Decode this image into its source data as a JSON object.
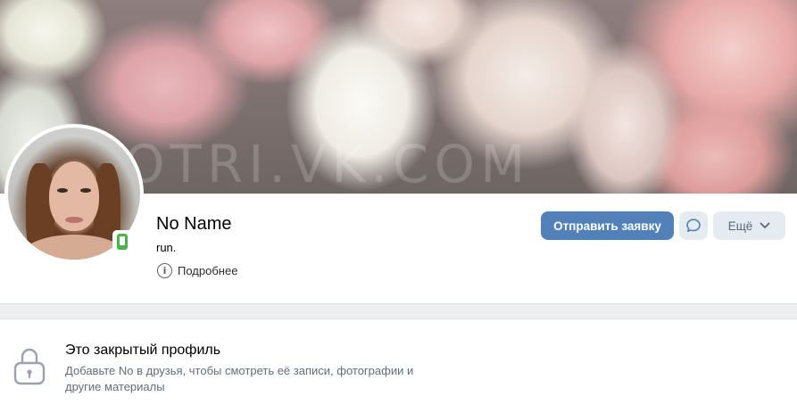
{
  "cover": {
    "watermark": "SMOTRI.VK.COM"
  },
  "profile": {
    "name": "No Name",
    "status": "run.",
    "details_label": "Подробнее",
    "online_device": "mobile"
  },
  "actions": {
    "send_request_label": "Отправить заявку",
    "more_label": "Ещё"
  },
  "private_notice": {
    "title": "Это закрытый профиль",
    "description": "Добавьте No в друзья, чтобы смотреть её записи, фотографии и другие материалы"
  },
  "icons": {
    "info": "info-icon",
    "message": "message-icon",
    "chevron": "chevron-down-icon",
    "lock": "lock-icon",
    "online": "mobile-online-icon"
  },
  "colors": {
    "primary_button": "#5181b8",
    "secondary_button": "#e5ebf1",
    "online_green": "#4bb34b",
    "page_background": "#edeef0"
  }
}
